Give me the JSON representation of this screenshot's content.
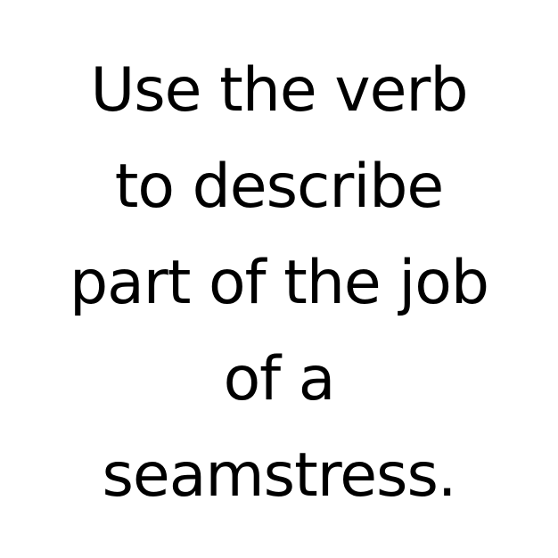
{
  "prompt": {
    "lines": [
      "Use the verb",
      "to describe",
      "part of the job",
      "of a",
      "seamstress."
    ]
  },
  "colors": {
    "background": "#ffffff",
    "text": "#000000"
  }
}
